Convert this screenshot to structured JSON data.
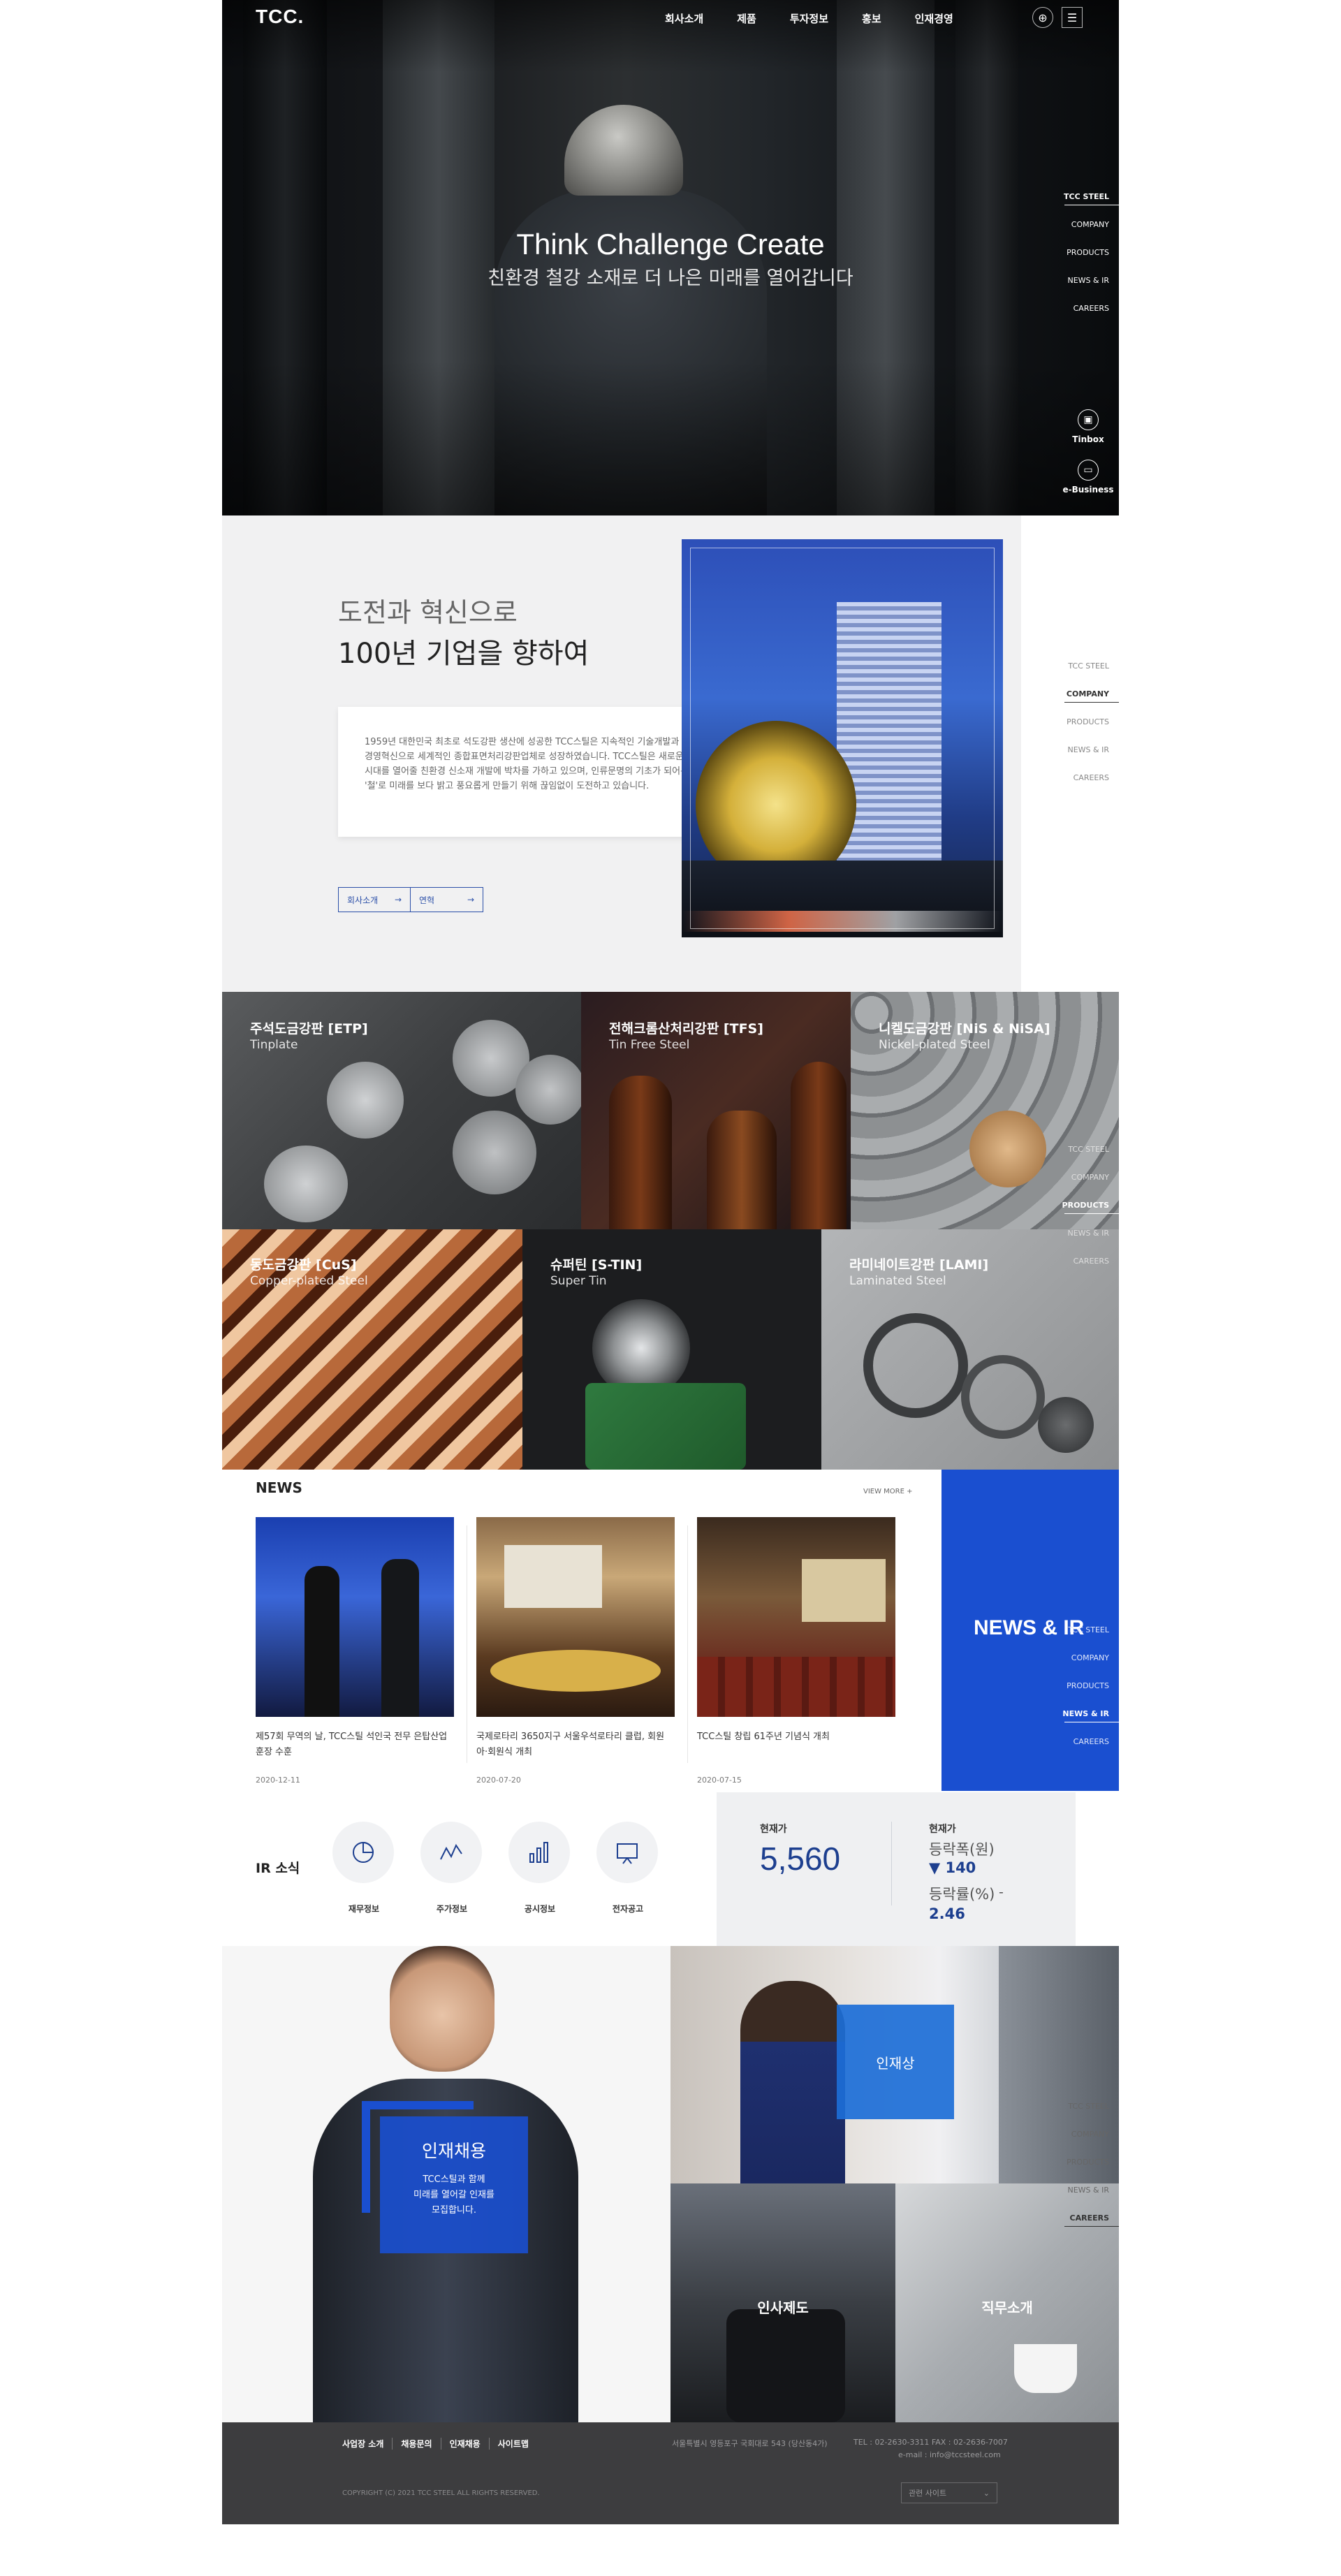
{
  "nav": {
    "logo": "TCC.",
    "menu": [
      "회사소개",
      "제품",
      "투자정보",
      "홍보",
      "인재경영"
    ],
    "globe_icon": "globe-icon",
    "menu_icon": "hamburger-menu-icon"
  },
  "hero": {
    "title": "Think Challenge Create",
    "subtitle": "친환경 철강 소재로 더 나은 미래를 열어갑니다"
  },
  "sidenav": {
    "items": [
      "TCC STEEL",
      "COMPANY",
      "PRODUCTS",
      "NEWS & IR",
      "CAREERS"
    ]
  },
  "quick": {
    "tinbox": "Tinbox",
    "ebusiness": "e-Business"
  },
  "intro": {
    "heading_light": "도전과 혁신으로",
    "heading_bold": "100년 기업을 향하여",
    "body": "1959년 대한민국 최초로 석도강판 생산에 성공한 TCC스틸은 지속적인 기술개발과 경영혁신으로 세계적인 종합표면처리강판업체로 성장하였습니다. TCC스틸은 새로운 시대를 열어줄 친환경 신소재 개발에 박차를 가하고 있으며, 인류문명의 기초가 되어온 '철'로 미래를 보다 밝고 풍요롭게 만들기 위해 끊임없이 도전하고 있습니다.",
    "buttons": [
      "회사소개",
      "연혁"
    ]
  },
  "products": [
    {
      "ko": "주석도금강판 [ETP]",
      "en": "Tinplate"
    },
    {
      "ko": "전해크롬산처리강판 [TFS]",
      "en": "Tin Free Steel"
    },
    {
      "ko": "니켈도금강판 [NiS & NiSA]",
      "en": "Nickel-plated Steel"
    },
    {
      "ko": "동도금강판 [CuS]",
      "en": "Copper-plated Steel"
    },
    {
      "ko": "슈퍼틴 [S-TIN]",
      "en": "Super Tin"
    },
    {
      "ko": "라미네이트강판 [LAMI]",
      "en": "Laminated Steel"
    }
  ],
  "news": {
    "title": "NEWS",
    "more": "VIEW MORE +",
    "banner": "NEWS & IR",
    "items": [
      {
        "title": "제57회 무역의 날, TCC스틸 석인국 전무 은탑산업훈장 수훈",
        "date": "2020-12-11"
      },
      {
        "title": "국제로타리 3650지구 서울우석로타리 클럽, 회원 아·회원식 개최",
        "date": "2020-07-20"
      },
      {
        "title": "TCC스틸 창립 61주년 기념식 개최",
        "date": "2020-07-15"
      }
    ]
  },
  "ir": {
    "label": "IR 소식",
    "items": [
      {
        "label": "재무정보",
        "icon": "pie-chart-icon"
      },
      {
        "label": "주가정보",
        "icon": "line-chart-icon"
      },
      {
        "label": "공시정보",
        "icon": "bar-chart-icon"
      },
      {
        "label": "전자공고",
        "icon": "presentation-board-icon"
      }
    ],
    "stock": {
      "price_label": "현재가",
      "price": "5,560",
      "current_label": "현재가",
      "change_label": "등락폭(원)",
      "change_value": "▼ 140",
      "rate_label": "등락률(%)",
      "rate_sign": "-",
      "rate_value": "2.46"
    }
  },
  "careers": {
    "recruit_title": "인재채용",
    "recruit_desc": "TCC스틸과 함께\n미래를 열어갈 인재를\n모집합니다.",
    "talent": "인재상",
    "hr_system": "인사제도",
    "job_intro": "직무소개"
  },
  "footer": {
    "links": [
      "사업장 소개",
      "채용문의",
      "인재채용",
      "사이트맵"
    ],
    "address": "서울특별시 영등포구 국회대로 543 (당산동4가)",
    "tel": "TEL : 02-2630-3311 FAX : 02-2636-7007",
    "email": "e-mail : info@tccsteel.com",
    "copyright": "COPYRIGHT (C) 2021 TCC STEEL ALL RIGHTS RESERVED.",
    "family_site": "관련 사이트"
  },
  "colors": {
    "brand_blue": "#1a4fd0",
    "dark_navy": "#1d3f8f",
    "footer_bg": "#3d3d3f"
  }
}
